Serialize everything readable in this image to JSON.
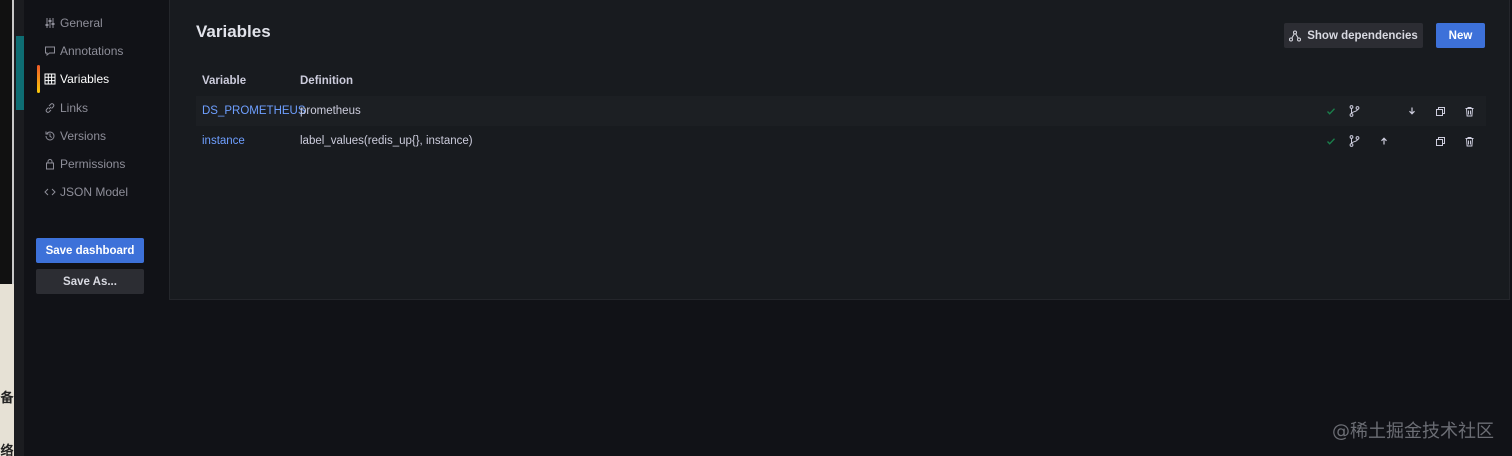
{
  "sidebar": {
    "items": [
      {
        "label": "General",
        "icon": "sliders-icon"
      },
      {
        "label": "Annotations",
        "icon": "comment-icon"
      },
      {
        "label": "Variables",
        "icon": "grid-icon"
      },
      {
        "label": "Links",
        "icon": "link-icon"
      },
      {
        "label": "Versions",
        "icon": "history-icon"
      },
      {
        "label": "Permissions",
        "icon": "lock-icon"
      },
      {
        "label": "JSON Model",
        "icon": "code-icon"
      }
    ],
    "active": "Variables",
    "save_label": "Save dashboard",
    "save_as_label": "Save As..."
  },
  "main": {
    "title": "Variables",
    "show_dependencies_label": "Show dependencies",
    "new_label": "New",
    "table": {
      "headers": [
        "Variable",
        "Definition"
      ],
      "rows": [
        {
          "name": "DS_PROMETHEUS",
          "definition": "prometheus"
        },
        {
          "name": "instance",
          "definition": "label_values(redis_up{}, instance)"
        }
      ]
    }
  },
  "watermark": "@稀土掘金技术社区",
  "left_strip": {
    "glyph1": "备",
    "glyph2": "络"
  },
  "colors": {
    "accent": "#3d71d9",
    "link": "#6e9fff",
    "check": "#1a7f4b",
    "background": "#111217",
    "panel": "#181b1f"
  }
}
